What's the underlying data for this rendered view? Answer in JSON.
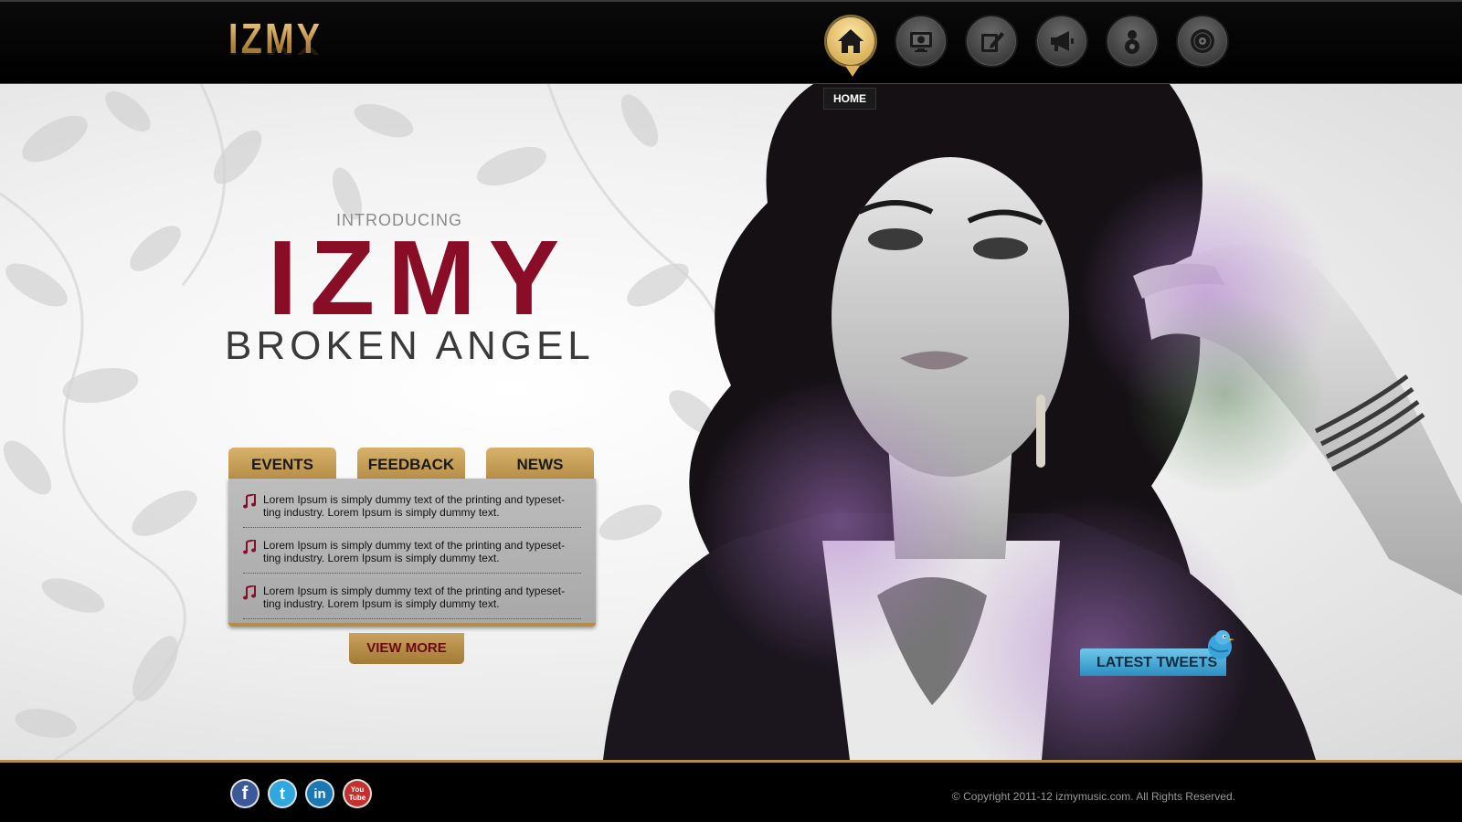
{
  "header": {
    "logo_text": "IZMY",
    "nav": [
      {
        "id": "home",
        "icon": "home-icon",
        "active": true
      },
      {
        "id": "media",
        "icon": "monitor-icon",
        "active": false
      },
      {
        "id": "blog",
        "icon": "edit-icon",
        "active": false
      },
      {
        "id": "news",
        "icon": "megaphone-icon",
        "active": false
      },
      {
        "id": "about",
        "icon": "person-icon",
        "active": false
      },
      {
        "id": "music",
        "icon": "disc-icon",
        "active": false
      }
    ],
    "tooltip": "HOME"
  },
  "hero": {
    "intro": "INTRODUCING",
    "title": "IZMY",
    "subtitle": "BROKEN ANGEL"
  },
  "tabs": {
    "items": [
      "EVENTS",
      "FEEDBACK",
      "NEWS"
    ],
    "entries": [
      "Lorem Ipsum is simply dummy text of the printing and typeset-ting industry. Lorem Ipsum is simply dummy text.",
      "Lorem Ipsum is simply dummy text of the printing and typeset-ting industry. Lorem Ipsum is simply dummy text.",
      "Lorem Ipsum is simply dummy text of the printing and typeset-ting industry. Lorem Ipsum is simply dummy text."
    ],
    "view_more": "VIEW MORE"
  },
  "tweets": {
    "label": "LATEST TWEETS"
  },
  "footer": {
    "social": [
      {
        "name": "facebook-icon",
        "glyph": "f",
        "color": "#3b5998"
      },
      {
        "name": "twitter-icon",
        "glyph": "t",
        "color": "#2fa8e0"
      },
      {
        "name": "linkedin-icon",
        "glyph": "in",
        "color": "#1a79b5"
      },
      {
        "name": "youtube-icon",
        "glyph": "You Tube",
        "color": "#c4302b"
      }
    ],
    "copyright": "© Copyright 2011-12 izmymusic.com. All Rights Reserved."
  },
  "colors": {
    "accent_gold": "#b58c45",
    "title_red": "#8a0d28",
    "tweet_blue": "#2c8fc0"
  }
}
